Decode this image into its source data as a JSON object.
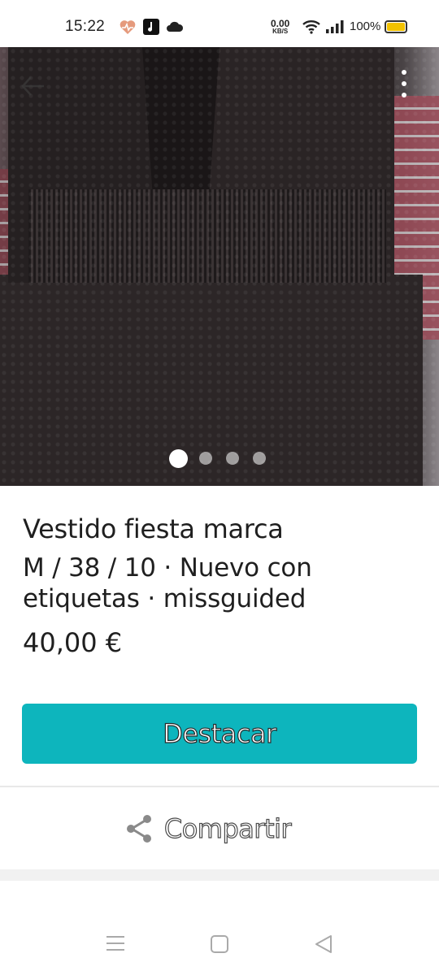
{
  "status_bar": {
    "time": "15:22",
    "network_speed_value": "0.00",
    "network_speed_unit": "KB/S",
    "battery": "100%",
    "icons": [
      "heart-monitor-icon",
      "music-app-icon",
      "cloud-icon",
      "wifi-icon",
      "signal-icon",
      "battery-icon"
    ],
    "battery_color": "#f2c200"
  },
  "gallery": {
    "image_count": 4,
    "active_index": 0,
    "icons": [
      "back-arrow-icon",
      "more-vertical-icon"
    ]
  },
  "product": {
    "title": "Vestido fiesta marca",
    "details": "M / 38 / 10 · Nuevo con etiquetas · missguided",
    "price": "40,00 €"
  },
  "actions": {
    "highlight_label": "Destacar",
    "share_label": "Compartir",
    "accent_color": "#0db5bd"
  },
  "nav_bar": {
    "icons": [
      "menu-icon",
      "home-square-icon",
      "back-triangle-icon"
    ]
  }
}
